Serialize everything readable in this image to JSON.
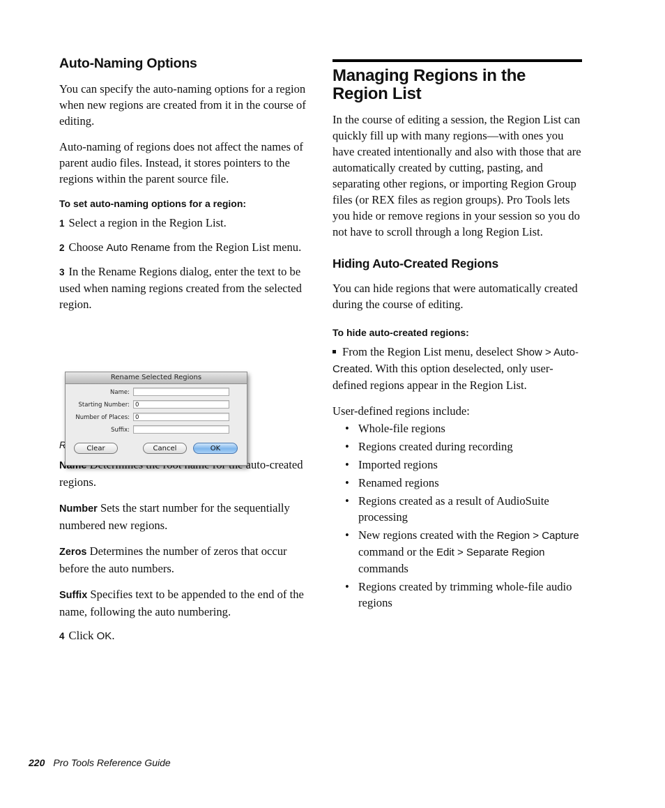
{
  "left": {
    "heading": "Auto-Naming Options",
    "para1": "You can specify the auto-naming options for a region when new regions are created from it in the course of editing.",
    "para2": "Auto-naming of regions does not affect the names of parent audio files. Instead, it stores pointers to the regions within the parent source file.",
    "procedure": "To set auto-naming options for a region:",
    "steps": [
      {
        "num": "1",
        "text": "Select a region in the Region List."
      },
      {
        "num": "2",
        "pre": "Choose ",
        "ui": "Auto Rename",
        "post": " from the Region List menu."
      },
      {
        "num": "3",
        "text": "In the Rename Regions dialog, enter the text to be used when naming regions created from the selected region."
      },
      {
        "num": "4",
        "pre": "Click ",
        "ui": "OK",
        "post": "."
      }
    ],
    "caption": "Rename Selected Regions dialog",
    "terms": [
      {
        "term": "Name",
        "desc": " Determines the root name for the auto-created regions."
      },
      {
        "term": "Number",
        "desc": " Sets the start number for the sequentially numbered new regions."
      },
      {
        "term": "Zeros",
        "desc": " Determines the number of zeros that occur before the auto numbers."
      },
      {
        "term": "Suffix",
        "desc": " Specifies text to be appended to the end of the name, following the auto numbering."
      }
    ]
  },
  "dialog": {
    "title": "Rename Selected Regions",
    "fields": [
      {
        "label": "Name:",
        "value": ""
      },
      {
        "label": "Starting Number:",
        "value": "0"
      },
      {
        "label": "Number of Places:",
        "value": "0"
      },
      {
        "label": "Suffix:",
        "value": ""
      }
    ],
    "buttons": {
      "clear": "Clear",
      "cancel": "Cancel",
      "ok": "OK"
    }
  },
  "right": {
    "heading": "Managing Regions in the Region List",
    "para1": "In the course of editing a session, the Region List can quickly fill up with many regions—with ones you have created intentionally and also with those that are automatically created by cutting, pasting, and separating other regions, or importing Region Group files (or REX files as region groups). Pro Tools lets you hide or remove regions in your session so you do not have to scroll through a long Region List.",
    "subheading": "Hiding Auto-Created Regions",
    "para2": "You can hide regions that were automatically created during the course of editing.",
    "procedure": "To hide auto-created regions:",
    "single_step": {
      "pre": "From the Region List menu, deselect ",
      "ui": "Show > Auto-Created",
      "post": ". With this option deselected, only user-defined regions appear in the Region List."
    },
    "list_intro": "User-defined regions include:",
    "bullets": [
      {
        "pre": "Whole-file regions"
      },
      {
        "pre": "Regions created during recording"
      },
      {
        "pre": "Imported regions"
      },
      {
        "pre": "Renamed regions"
      },
      {
        "pre": "Regions created as a result of AudioSuite processing"
      },
      {
        "pre": "New regions created with the ",
        "ui1": "Region > Capture",
        "mid": " command or the ",
        "ui2": "Edit > Separate Region",
        "post": " commands"
      },
      {
        "pre": "Regions created by trimming whole-file audio regions"
      }
    ]
  },
  "footer": {
    "page": "220",
    "title": "Pro Tools Reference Guide"
  }
}
